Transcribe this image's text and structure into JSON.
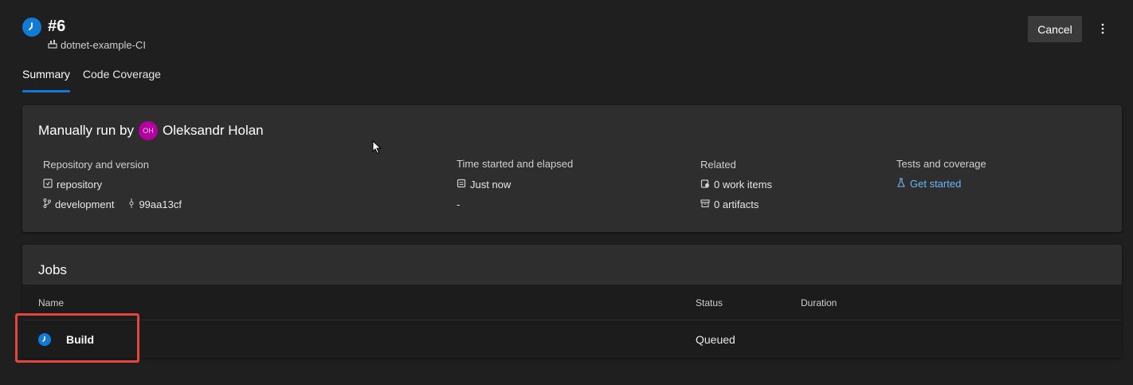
{
  "header": {
    "run_number": "#6",
    "pipeline_name": "dotnet-example-CI",
    "run_status_icon": "clock-icon",
    "cancel_label": "Cancel",
    "more_icon": "more-vertical-icon"
  },
  "tabs": [
    {
      "label": "Summary",
      "active": true
    },
    {
      "label": "Code Coverage",
      "active": false
    }
  ],
  "summary": {
    "manual_prefix": "Manually run by",
    "user_initials": "OH",
    "user_name": "Oleksandr Holan",
    "repository_label": "Repository and version",
    "repository_name": "repository",
    "branch": "development",
    "commit": "99aa13cf",
    "time_label": "Time started and elapsed",
    "time_started": "Just now",
    "elapsed": "-",
    "related_label": "Related",
    "work_items": "0 work items",
    "artifacts": "0 artifacts",
    "tests_label": "Tests and coverage",
    "tests_link": "Get started"
  },
  "jobs": {
    "title": "Jobs",
    "columns": {
      "name": "Name",
      "status": "Status",
      "duration": "Duration"
    },
    "rows": [
      {
        "name": "Build",
        "status": "Queued",
        "duration": ""
      }
    ]
  },
  "colors": {
    "accent": "#0f7bd7",
    "avatar": "#b4009e",
    "link": "#6cb8f6",
    "highlight": "#e5453f"
  }
}
